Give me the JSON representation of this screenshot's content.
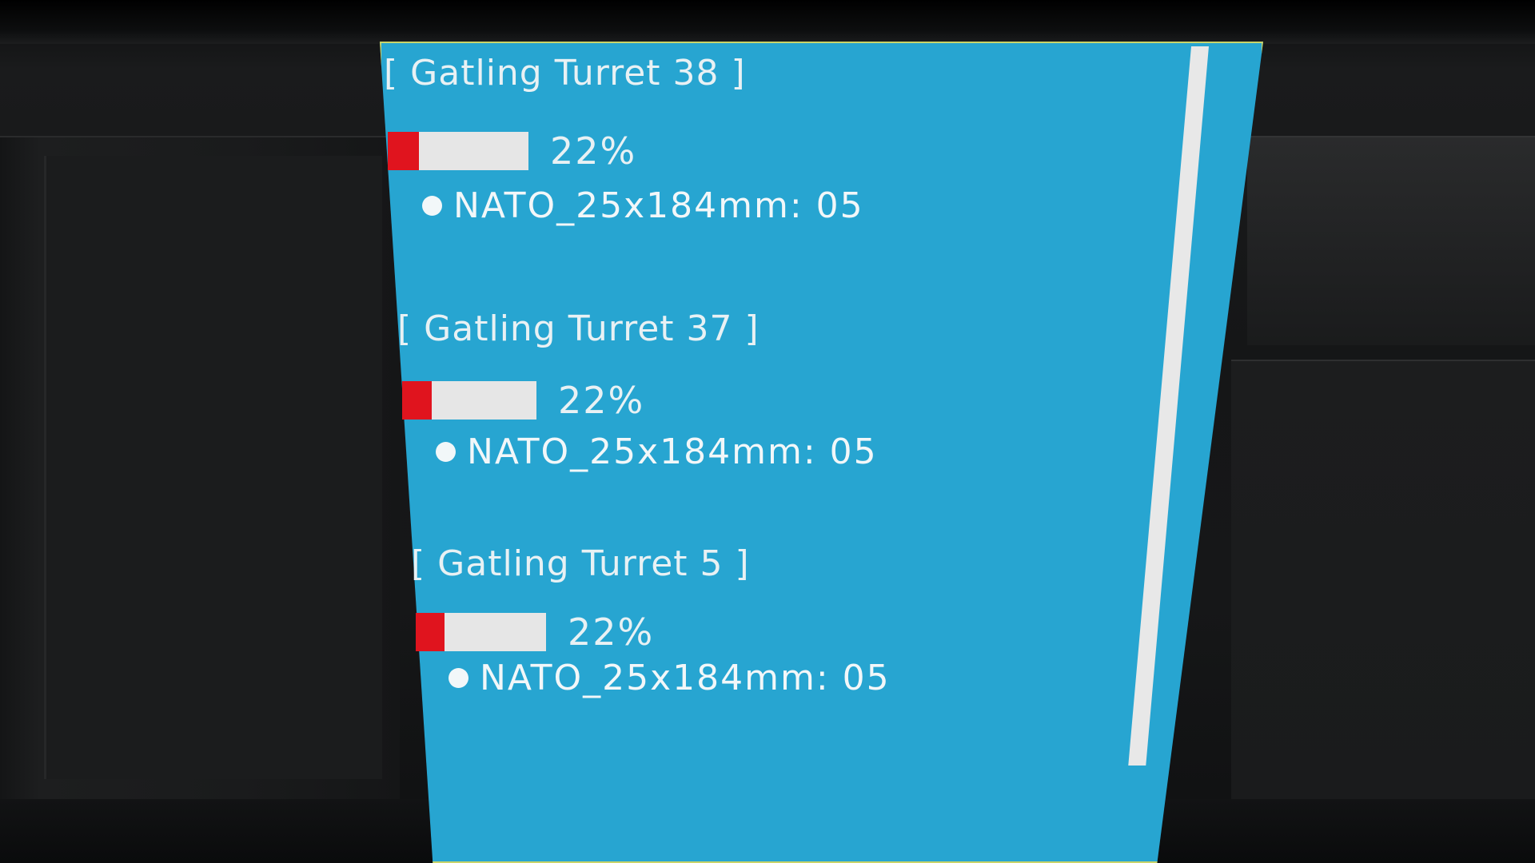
{
  "lcd": {
    "screen_color": "#27a5d1",
    "bar_fill_color": "#e0141e",
    "turrets": [
      {
        "title": "[ Gatling Turret 38 ]",
        "percent_label": "22%",
        "ammo_fraction": 0.22,
        "ammo_label": "NATO_25x184mm: 05"
      },
      {
        "title": "[ Gatling Turret 37 ]",
        "percent_label": "22%",
        "ammo_fraction": 0.22,
        "ammo_label": "NATO_25x184mm: 05"
      },
      {
        "title": "[ Gatling Turret 5 ]",
        "percent_label": "22%",
        "ammo_fraction": 0.22,
        "ammo_label": "NATO_25x184mm: 05"
      }
    ]
  }
}
